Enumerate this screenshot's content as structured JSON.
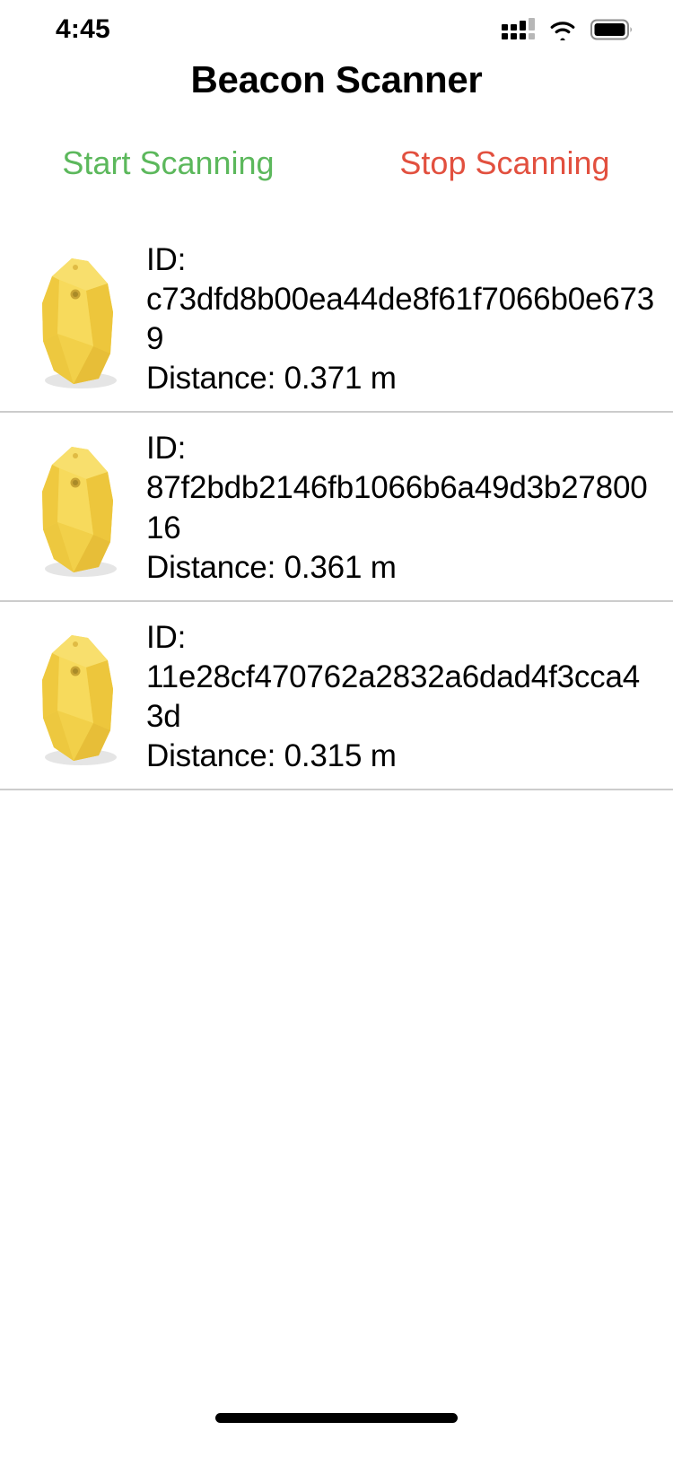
{
  "status_bar": {
    "time": "4:45",
    "cellular_icon": "cellular-signal-icon",
    "wifi_icon": "wifi-icon",
    "battery_icon": "battery-full-icon"
  },
  "header": {
    "title": "Beacon Scanner"
  },
  "controls": {
    "start_label": "Start Scanning",
    "stop_label": "Stop Scanning",
    "start_color": "#5CB85C",
    "stop_color": "#E2503F"
  },
  "beacons": [
    {
      "icon": "beacon-tag-icon",
      "id_label": "ID:",
      "id_value": "c73dfd8b00ea44de8f61f7066b0e6739",
      "distance": "Distance: 0.371 m"
    },
    {
      "icon": "beacon-tag-icon",
      "id_label": "ID:",
      "id_value": "87f2bdb2146fb1066b6a49d3b2780016",
      "distance": "Distance: 0.361 m"
    },
    {
      "icon": "beacon-tag-icon",
      "id_label": "ID:",
      "id_value": "11e28cf470762a2832a6dad4f3cca43d",
      "distance": "Distance: 0.315 m"
    }
  ],
  "home_indicator": "home-indicator",
  "colors": {
    "background": "#ffffff",
    "text": "#000000",
    "separator": "#cccccc",
    "beacon_yellow": "#F4D44B",
    "beacon_yellow_light": "#F8E07A",
    "beacon_yellow_dark": "#E0BD3C"
  }
}
